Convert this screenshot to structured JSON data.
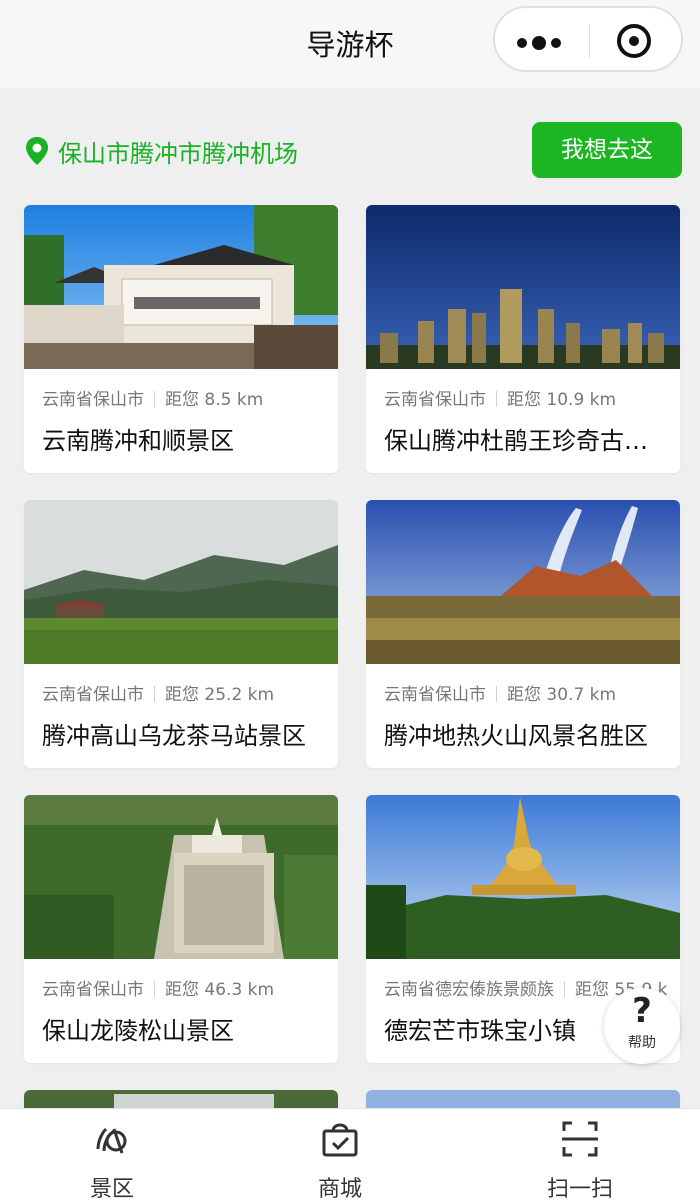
{
  "nav": {
    "title": "导游杯"
  },
  "location": {
    "text": "保山市腾冲市腾冲机场",
    "button_label": "我想去这"
  },
  "cards": [
    {
      "region": "云南省保山市",
      "distance": "距您 8.5 km",
      "name": "云南腾冲和顺景区"
    },
    {
      "region": "云南省保山市",
      "distance": "距您 10.9 km",
      "name": "保山腾冲杜鹃王珍奇古…"
    },
    {
      "region": "云南省保山市",
      "distance": "距您 25.2 km",
      "name": "腾冲高山乌龙茶马站景区"
    },
    {
      "region": "云南省保山市",
      "distance": "距您 30.7 km",
      "name": "腾冲地热火山风景名胜区"
    },
    {
      "region": "云南省保山市",
      "distance": "距您 46.3 km",
      "name": "保山龙陵松山景区"
    },
    {
      "region": "云南省德宏傣族景颇族",
      "distance": "距您 55.9 k",
      "name": "德宏芒市珠宝小镇"
    }
  ],
  "help": {
    "label": "帮助"
  },
  "tabbar": {
    "tab1": "景区",
    "tab2": "商城",
    "tab3": "扫一扫"
  },
  "colors": {
    "accent": "#1cb625",
    "accent_text": "#19b125",
    "background": "#efefef"
  }
}
